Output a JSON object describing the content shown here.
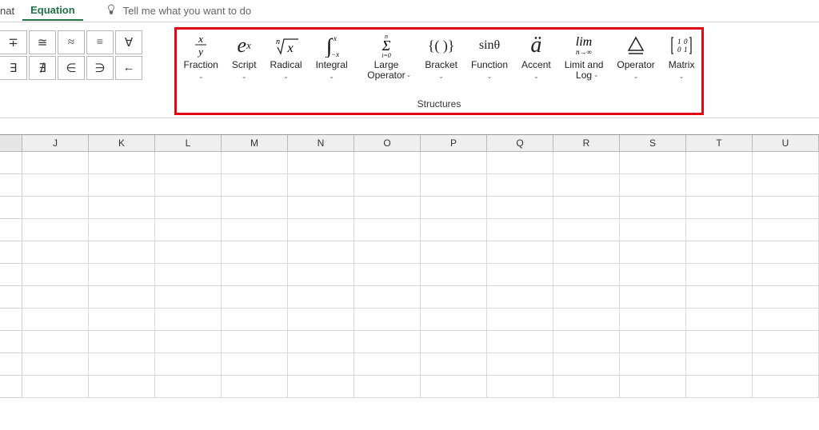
{
  "tabs": {
    "partial": "nat",
    "active": "Equation"
  },
  "tellme": {
    "placeholder": "Tell me what you want to do"
  },
  "symbols_row1": [
    "∓",
    "≅",
    "≈",
    "≡",
    "∀"
  ],
  "symbols_row2": [
    "∃",
    "∄",
    "∈",
    "∋",
    "←"
  ],
  "structures": {
    "items": [
      {
        "label": "Fraction"
      },
      {
        "label": "Script"
      },
      {
        "label": "Radical"
      },
      {
        "label": "Integral"
      },
      {
        "label": "Large\nOperator"
      },
      {
        "label": "Bracket"
      },
      {
        "label": "Function"
      },
      {
        "label": "Accent"
      },
      {
        "label": "Limit and\nLog"
      },
      {
        "label": "Operator"
      },
      {
        "label": "Matrix"
      }
    ],
    "group_label": "Structures"
  },
  "columns": [
    "J",
    "K",
    "L",
    "M",
    "N",
    "O",
    "P",
    "Q",
    "R",
    "S",
    "T",
    "U"
  ],
  "row_count": 11
}
